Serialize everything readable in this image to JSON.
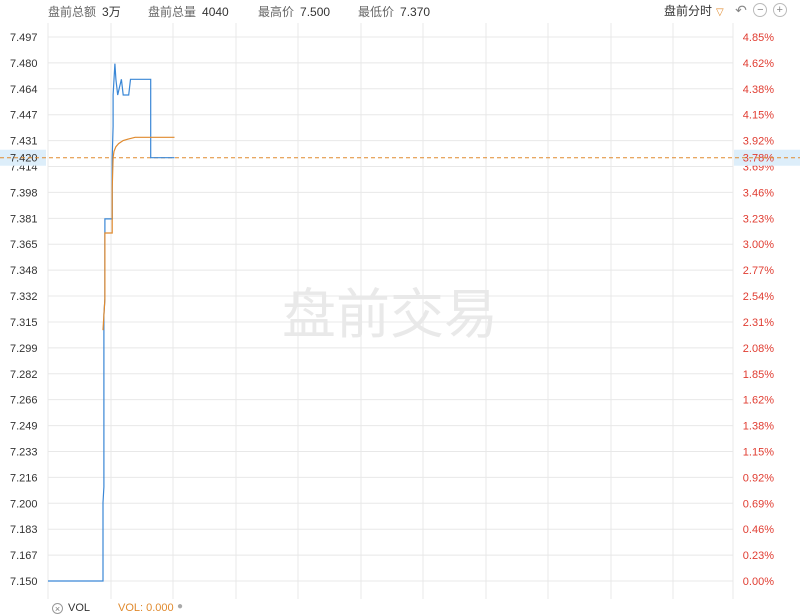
{
  "header": {
    "stats": [
      {
        "label": "盘前总额",
        "value": "3万"
      },
      {
        "label": "盘前总量",
        "value": "4040"
      },
      {
        "label": "最高价",
        "value": "7.500"
      },
      {
        "label": "最低价",
        "value": "7.370"
      }
    ],
    "mode_label": "盘前分时",
    "icons": [
      "undo-icon",
      "zoom-out-icon",
      "zoom-in-icon"
    ]
  },
  "watermark": "盘前交易",
  "indicator": {
    "name": "VOL",
    "readout": "VOL: 0.000"
  },
  "colors": {
    "price_line": "#3a87d6",
    "avg_line": "#e08a2e",
    "axis_red": "#e03c31",
    "grid": "#e8e8e8",
    "highlight": "#ddeefa"
  },
  "chart_data": {
    "type": "line",
    "ylim": [
      7.15,
      7.497
    ],
    "y_ticks_left": [
      "7.497",
      "7.480",
      "7.464",
      "7.447",
      "7.431",
      "7.414",
      "7.398",
      "7.381",
      "7.365",
      "7.348",
      "7.332",
      "7.315",
      "7.299",
      "7.282",
      "7.266",
      "7.249",
      "7.233",
      "7.216",
      "7.200",
      "7.183",
      "7.167",
      "7.150"
    ],
    "y_ticks_right": [
      "4.85%",
      "4.62%",
      "4.38%",
      "4.15%",
      "3.92%",
      "3.69%",
      "3.46%",
      "3.23%",
      "3.00%",
      "2.77%",
      "2.54%",
      "2.31%",
      "2.08%",
      "1.85%",
      "1.62%",
      "1.38%",
      "1.15%",
      "0.92%",
      "0.69%",
      "0.46%",
      "0.23%",
      "0.00%"
    ],
    "reference": {
      "price": 7.42,
      "label_left": "7.420",
      "label_right": "3.78%"
    },
    "x_range": [
      0,
      747
    ],
    "series": [
      {
        "key": "price",
        "x": [
          0,
          60,
          60,
          61,
          61,
          62,
          62,
          70,
          70,
          71,
          71,
          73,
          74,
          76,
          78,
          80,
          82,
          85,
          88,
          90,
          92,
          100,
          112,
          112,
          112,
          120,
          130,
          138
        ],
        "y": [
          7.15,
          7.15,
          7.2,
          7.21,
          7.32,
          7.33,
          7.381,
          7.381,
          7.42,
          7.44,
          7.46,
          7.48,
          7.47,
          7.46,
          7.465,
          7.47,
          7.46,
          7.46,
          7.46,
          7.47,
          7.47,
          7.47,
          7.47,
          7.42,
          7.42,
          7.42,
          7.42,
          7.42
        ]
      },
      {
        "key": "avg",
        "x": [
          60,
          62,
          62,
          70,
          70,
          71,
          72,
          74,
          77,
          82,
          88,
          95,
          105,
          115,
          138
        ],
        "y": [
          7.31,
          7.33,
          7.372,
          7.372,
          7.4,
          7.42,
          7.424,
          7.427,
          7.429,
          7.431,
          7.432,
          7.433,
          7.433,
          7.433,
          7.433
        ]
      }
    ]
  }
}
